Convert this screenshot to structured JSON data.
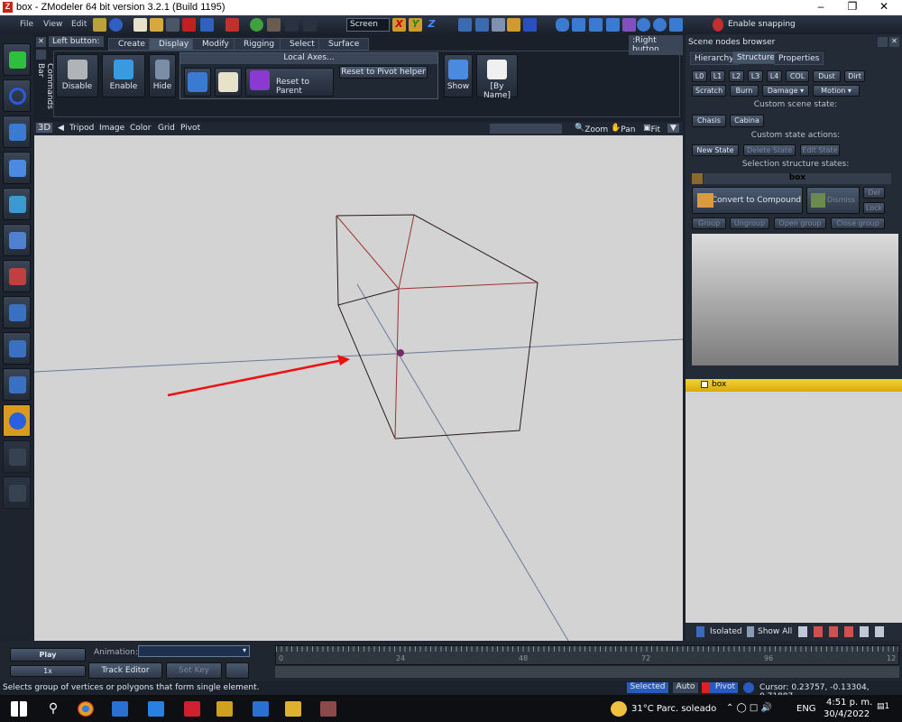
{
  "window": {
    "title": "box - ZModeler 64 bit version 3.2.1 (Build 1195)",
    "controls": [
      "minimize",
      "restore",
      "close"
    ]
  },
  "menu": [
    "File",
    "View",
    "Edit"
  ],
  "toolbar": {
    "view_combo": "Screen",
    "axes": [
      "X",
      "Y",
      "Z"
    ],
    "snapping_label": "Enable snapping"
  },
  "commands": {
    "left_button": "Left button:",
    "right_button": ":Right button",
    "side_label": "Commands Bar",
    "tabs": [
      "Create",
      "Display",
      "Modify",
      "Rigging",
      "Select",
      "Surface"
    ],
    "active_tab": "Display",
    "buttons": [
      "Disable",
      "Enable",
      "Hide"
    ],
    "local_axes": "Local Axes...",
    "reset_parent": "Reset to Parent",
    "reset_pivot": "Reset to Pivot helper",
    "show": "Show",
    "by_name": "[By Name]"
  },
  "viewport": {
    "mode": "3D",
    "menu": [
      "Tripod",
      "Image",
      "Color",
      "Grid",
      "Pivot"
    ],
    "zoom": "Zoom",
    "pan": "Pan",
    "fit": "Fit"
  },
  "scene": {
    "title": "Scene nodes browser",
    "tabs": [
      "Hierarchy",
      "Structure",
      "Properties"
    ],
    "active_tab": "Structure",
    "row1": [
      "L0",
      "L1",
      "L2",
      "L3",
      "L4",
      "COL",
      "Dust",
      "Dirt"
    ],
    "row2": [
      "Scratch",
      "Burn",
      "Damage",
      "Motion"
    ],
    "custom_scene_state": "Custom scene state:",
    "states": [
      "Chasis",
      "Cabina"
    ],
    "custom_state_actions": "Custom state actions:",
    "actions": [
      "New State",
      "Delete State",
      "Edit State"
    ],
    "selection_states": "Selection structure states:",
    "selected_name": "box",
    "convert": "Convert to Compound",
    "dismiss": "Dismiss",
    "del": "Del",
    "lock": "Lock",
    "group_buttons": [
      "Group",
      "Ungroup",
      "Open group",
      "Close group"
    ],
    "node": "box",
    "isolated": "Isolated",
    "show_all": "Show All"
  },
  "animation": {
    "play": "Play",
    "speed": "1x",
    "label": "Animation:",
    "value": "",
    "track_editor": "Track Editor",
    "set_key": "Set Key",
    "ticks": [
      "0",
      "24",
      "48",
      "72",
      "96",
      "12"
    ]
  },
  "status": {
    "hint": "Selects group of vertices or polygons that form single element.",
    "selected": "Selected",
    "auto": "Auto",
    "pivot": "Pivot",
    "cursor": "Cursor: 0.23757, -0.13304, 0.71887"
  },
  "taskbar": {
    "weather": "31°C  Parc. soleado",
    "lang": "ENG",
    "time": "4:51 p. m.",
    "date": "30/4/2022",
    "notifications": "1"
  }
}
